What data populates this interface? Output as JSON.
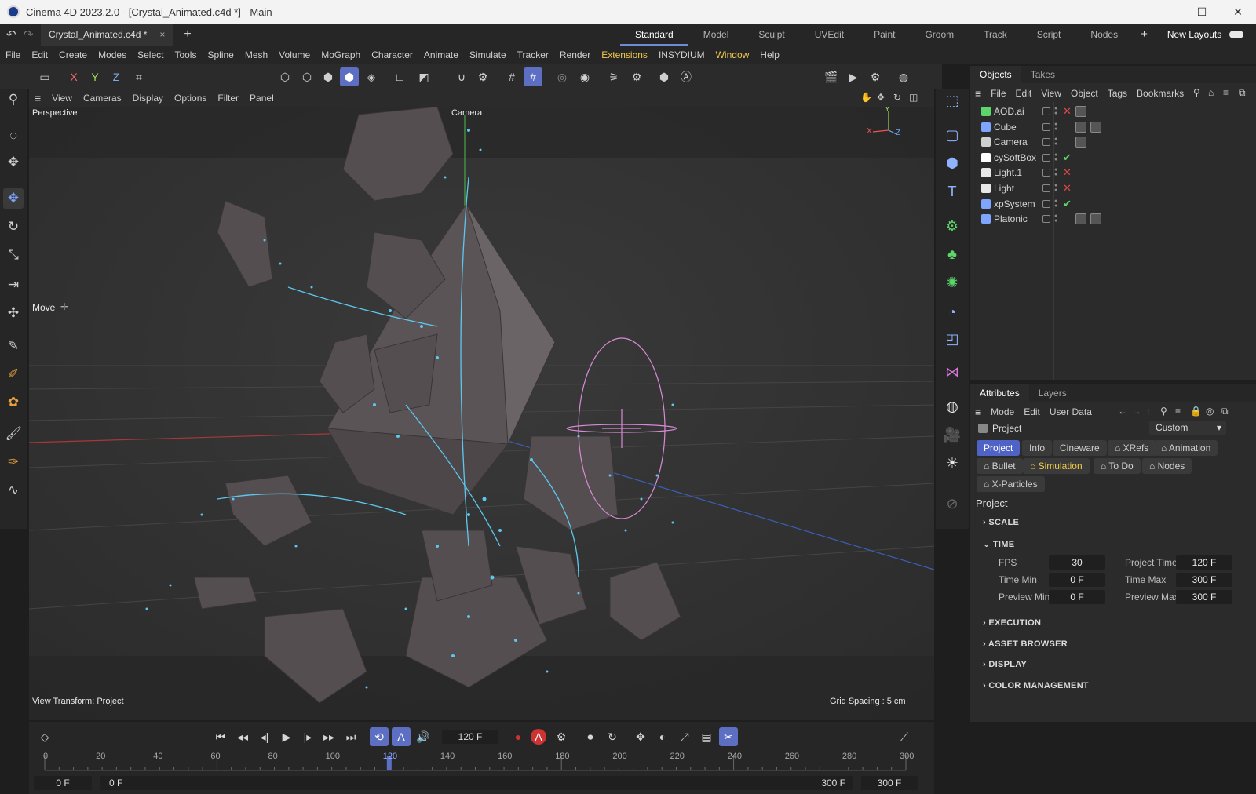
{
  "window": {
    "title": "Cinema 4D 2023.2.0 - [Crystal_Animated.c4d *] - Main",
    "minimize": "—",
    "maximize": "☐",
    "close": "✕"
  },
  "tabbar": {
    "document_tab": "Crystal_Animated.c4d *",
    "close": "×",
    "new_tab": "+",
    "layouts": [
      "Standard",
      "Model",
      "Sculpt",
      "UVEdit",
      "Paint",
      "Groom",
      "Track",
      "Script",
      "Nodes"
    ],
    "add_layout": "+",
    "new_layouts": "New Layouts"
  },
  "menu": [
    "File",
    "Edit",
    "Create",
    "Modes",
    "Select",
    "Tools",
    "Spline",
    "Mesh",
    "Volume",
    "MoGraph",
    "Character",
    "Animate",
    "Simulate",
    "Tracker",
    "Render",
    "Extensions",
    "INSYDIUM",
    "Window",
    "Help"
  ],
  "axis_lock": {
    "x": "X",
    "y": "Y",
    "z": "Z"
  },
  "viewport": {
    "menu": [
      "View",
      "Cameras",
      "Display",
      "Options",
      "Filter",
      "Panel"
    ],
    "projection": "Perspective",
    "camera": "Camera",
    "tool_label": "Move",
    "view_transform": "View Transform: Project",
    "grid_spacing": "Grid Spacing : 5 cm",
    "axis_x": "X",
    "axis_y": "Y",
    "axis_z": "Z"
  },
  "objects_panel": {
    "tabs": [
      "Objects",
      "Takes"
    ],
    "menu": [
      "File",
      "Edit",
      "View",
      "Object",
      "Tags",
      "Bookmarks"
    ],
    "rows": [
      {
        "name": "AOD.ai",
        "status": "✕",
        "status_color": "#e04848",
        "icon_color": "#5cd66a"
      },
      {
        "name": "Cube",
        "status": "",
        "status_color": "#e04848",
        "icon_color": "#7ea6ff"
      },
      {
        "name": "Camera",
        "status": "",
        "status_color": "#e04848",
        "icon_color": "#cfcfcf"
      },
      {
        "name": "cySoftBox",
        "status": "✔",
        "status_color": "#5cd66a",
        "icon_color": "#ffffff"
      },
      {
        "name": "Light.1",
        "status": "✕",
        "status_color": "#e04848",
        "icon_color": "#e8e8e8"
      },
      {
        "name": "Light",
        "status": "✕",
        "status_color": "#e04848",
        "icon_color": "#e8e8e8"
      },
      {
        "name": "xpSystem",
        "status": "✔",
        "status_color": "#5cd66a",
        "icon_color": "#7ea6ff"
      },
      {
        "name": "Platonic",
        "status": "",
        "status_color": "#e04848",
        "icon_color": "#7ea6ff"
      }
    ]
  },
  "attributes_panel": {
    "tabs": [
      "Attributes",
      "Layers"
    ],
    "menu": [
      "Mode",
      "Edit",
      "User Data"
    ],
    "object": "Project",
    "preset": "Custom",
    "subtabs_row1": [
      "Project",
      "Info",
      "Cineware",
      "XRefs",
      "Animation"
    ],
    "subtabs_row2": [
      "Bullet",
      "Simulation",
      "To Do",
      "Nodes"
    ],
    "subtabs_row3": [
      "X-Particles"
    ],
    "section_title": "Project",
    "sections": {
      "scale": "SCALE",
      "time": "TIME",
      "execution": "EXECUTION",
      "asset_browser": "ASSET BROWSER",
      "display": "DISPLAY",
      "color_management": "COLOR MANAGEMENT"
    },
    "fields": {
      "fps_label": "FPS",
      "fps": "30",
      "project_time_label": "Project Time",
      "project_time": "120 F",
      "time_min_label": "Time Min",
      "time_min": "0 F",
      "time_max_label": "Time Max",
      "time_max": "300 F",
      "preview_min_label": "Preview Min",
      "preview_min": "0 F",
      "preview_max_label": "Preview Max",
      "preview_max": "300 F"
    }
  },
  "timeline": {
    "current_frame": "120 F",
    "ticks": [
      "0",
      "20",
      "40",
      "60",
      "80",
      "100",
      "120",
      "140",
      "160",
      "180",
      "200",
      "220",
      "240",
      "260",
      "280",
      "300"
    ],
    "playhead_frame": 120,
    "max_frame": 300,
    "start_field": "0 F",
    "range_start": "0 F",
    "range_end": "300 F",
    "end_field": "300 F"
  }
}
